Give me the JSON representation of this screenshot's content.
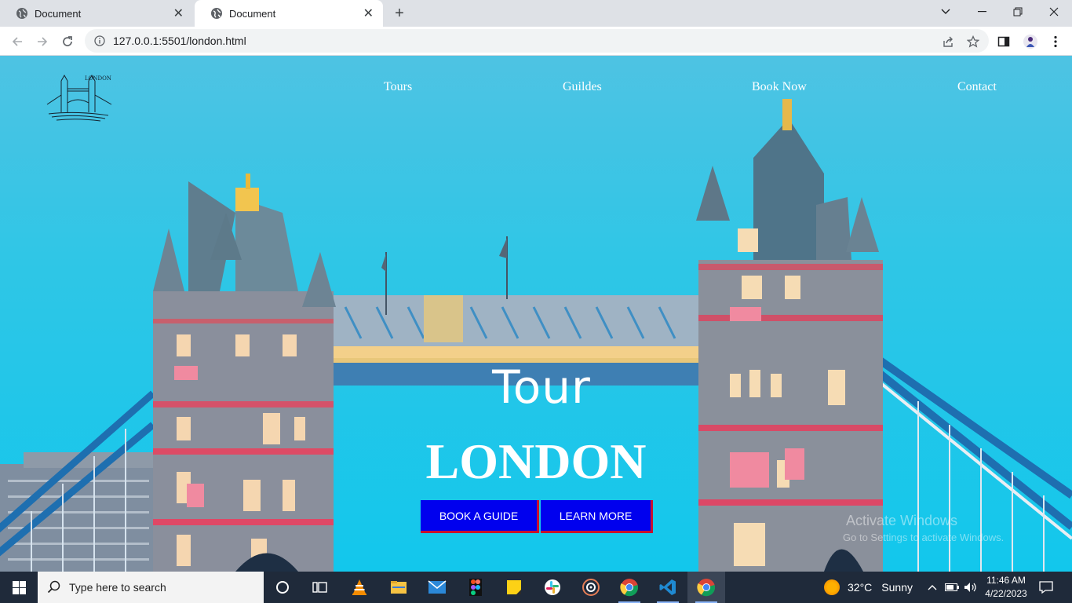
{
  "browser": {
    "tabs": [
      {
        "title": "Document",
        "active": false
      },
      {
        "title": "Document",
        "active": true
      }
    ],
    "url": "127.0.0.1:5501/london.html"
  },
  "site": {
    "logo_text": "LONDON",
    "nav": [
      "Tours",
      "Guildes",
      "Book Now",
      "Contact"
    ],
    "hero_line1": "Tour",
    "hero_line2": "LONDON",
    "buttons": [
      "BOOK A GUIDE",
      "LEARN MORE"
    ],
    "colors": {
      "button_bg": "#0000ee",
      "button_accent": "#c8102e",
      "sky": "#12c7ec"
    }
  },
  "watermark": {
    "line1": "Activate Windows",
    "line2": "Go to Settings to activate Windows."
  },
  "taskbar": {
    "search_placeholder": "Type here to search",
    "apps": [
      "cortana-icon",
      "task-view-icon",
      "vlc-icon",
      "file-explorer-icon",
      "mail-icon",
      "figma-icon",
      "sticky-notes-icon",
      "slack-icon",
      "media-icon",
      "chrome-icon",
      "vscode-icon",
      "chrome-icon"
    ],
    "weather_temp": "32°C",
    "weather_text": "Sunny",
    "time": "11:46 AM",
    "date": "4/22/2023"
  }
}
